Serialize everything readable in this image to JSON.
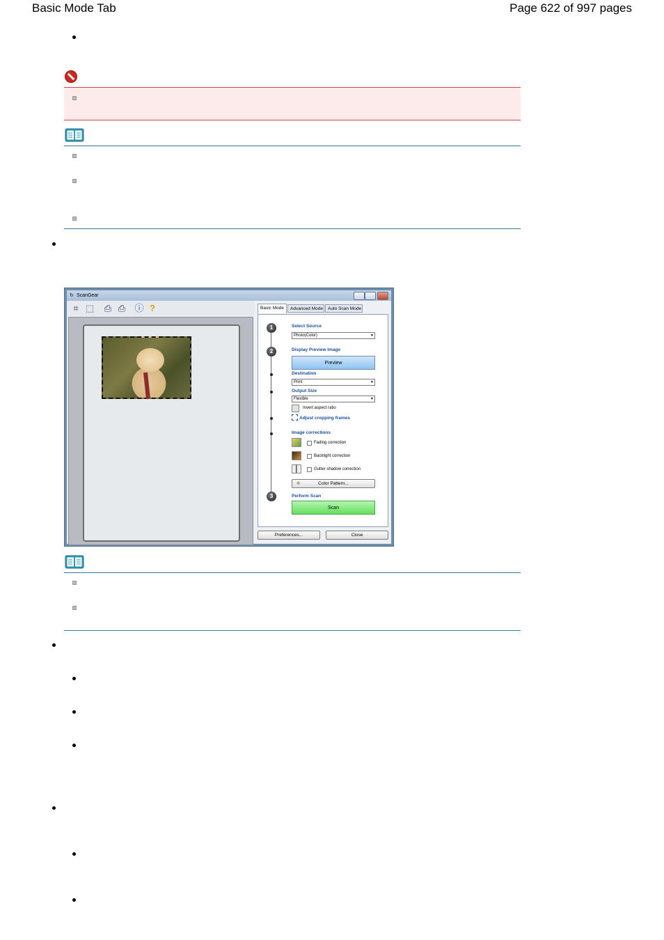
{
  "header": {
    "left": "Basic Mode Tab",
    "right": "Page 622 of 997 pages"
  },
  "window": {
    "title": "ScanGear",
    "toolbar_icons": [
      "crop-frame-icon",
      "delete-frame-icon",
      "rotate-left-icon",
      "rotate-right-icon",
      "info-icon",
      "help-icon"
    ],
    "tabs": [
      "Basic Mode",
      "Advanced Mode",
      "Auto Scan Mode"
    ],
    "active_tab": "Basic Mode",
    "steps": [
      {
        "number": "1",
        "label": "Select Source"
      },
      {
        "number": "2",
        "label": "Display Preview Image"
      },
      {
        "number": "3",
        "label": "Perform Scan"
      }
    ],
    "select_source_value": "Photo(Color)",
    "preview_button": "Preview",
    "destination_label": "Destination",
    "destination_value": "Print",
    "output_size_label": "Output Size",
    "output_size_value": "Flexible",
    "invert_aspect_label": "Invert aspect ratio",
    "adjust_cropping_label": "Adjust cropping frames",
    "image_corrections_label": "Image corrections",
    "fading_label": "Fading correction",
    "backlight_label": "Backlight correction",
    "gutter_label": "Gutter shadow correction",
    "color_pattern_button": "Color Pattern...",
    "scan_button": "Scan",
    "preferences_button": "Preferences...",
    "close_button": "Close"
  },
  "colors": {
    "alert_bg": "#fdeaea",
    "alert_border": "#d24a4a",
    "note_rule": "#2f7a9a"
  }
}
